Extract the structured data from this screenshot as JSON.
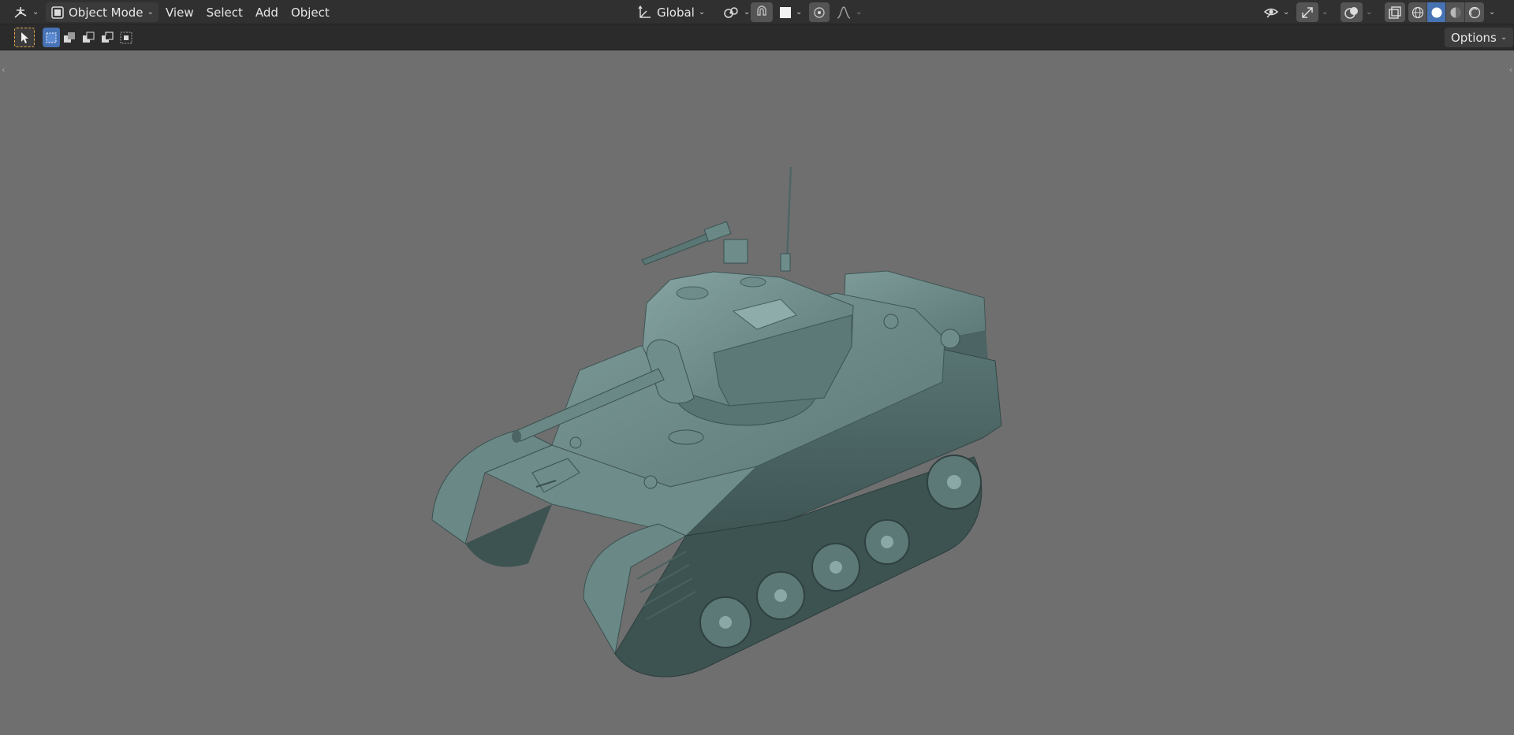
{
  "header": {
    "editor_type_icon": "viewport-3d-icon",
    "mode": {
      "icon": "object-mode-icon",
      "label": "Object Mode"
    },
    "menus": [
      "View",
      "Select",
      "Add",
      "Object"
    ],
    "transform_orientation": {
      "icon": "orientation-axis-icon",
      "label": "Global"
    },
    "pivot_icon": "pivot-point-icon",
    "snap_icon": "snap-magnet-icon",
    "snap_target_icon": "snap-square-icon",
    "proportional_edit_icon": "proportional-edit-icon",
    "falloff_icon": "falloff-curve-icon",
    "visibility_icon": "eye-icon",
    "gizmo_icon": "gizmo-arrow-icon",
    "overlay_icon": "overlay-circles-icon",
    "xray_icon": "xray-icon",
    "shading_modes": [
      {
        "name": "wireframe-shading-icon",
        "active": false
      },
      {
        "name": "solid-shading-icon",
        "active": true
      },
      {
        "name": "material-preview-shading-icon",
        "active": false
      },
      {
        "name": "rendered-shading-icon",
        "active": false
      }
    ]
  },
  "toolsettings": {
    "active_tool_icon": "select-cursor-icon",
    "selection_modes": [
      {
        "name": "select-set-icon",
        "active": true
      },
      {
        "name": "select-extend-icon",
        "active": false
      },
      {
        "name": "select-subtract-icon",
        "active": false
      },
      {
        "name": "select-difference-icon",
        "active": false
      },
      {
        "name": "select-intersect-icon",
        "active": false
      }
    ],
    "options_label": "Options"
  },
  "viewport": {
    "background": "#6f6f6f",
    "model_color": "#5d7a79",
    "left_toggle": "‹",
    "right_toggle": "‹"
  },
  "colors": {
    "header_bg": "#303030",
    "toolbar_bg": "#2b2b2b",
    "accent": "#4772b3",
    "active_tool": "#e8a64a"
  }
}
